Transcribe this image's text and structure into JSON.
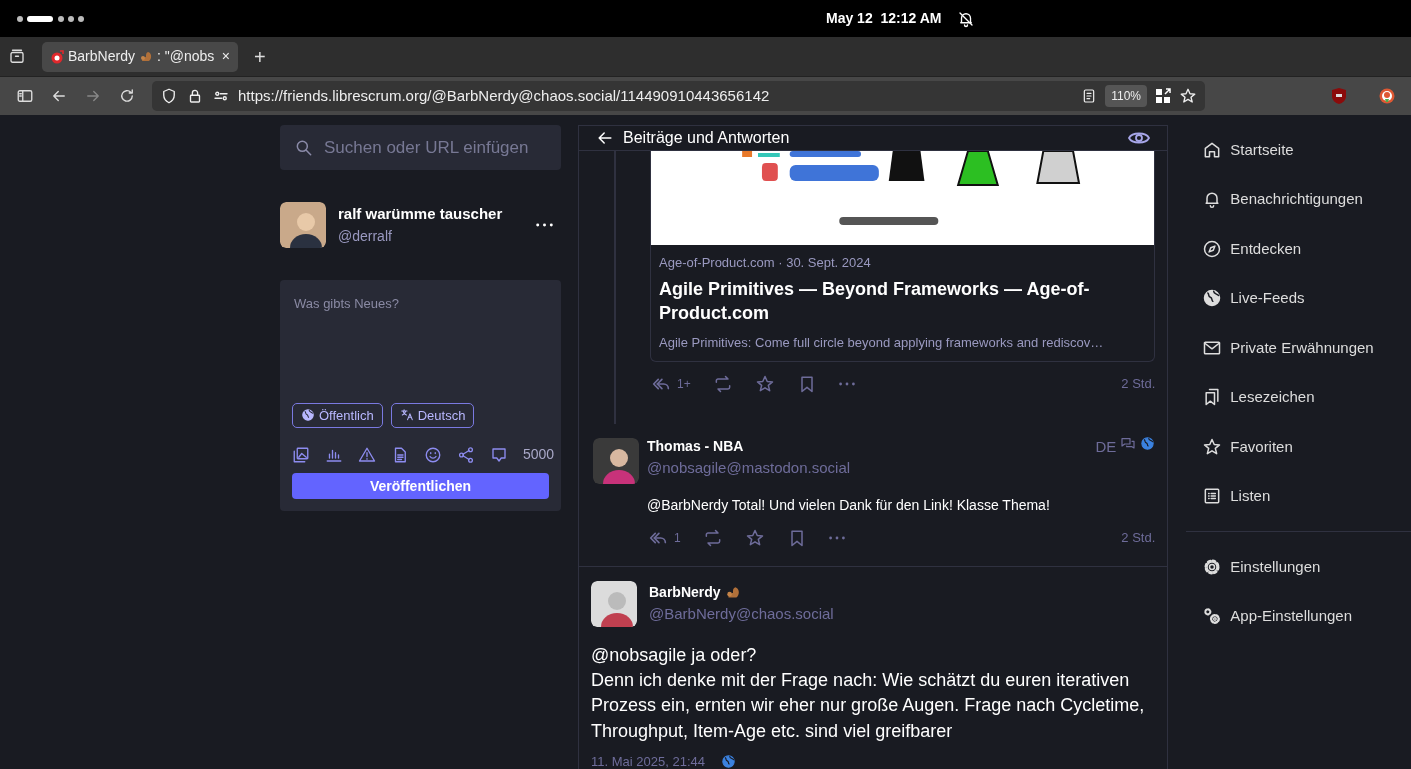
{
  "system_bar": {
    "date": "May 12",
    "time": "12:12 AM"
  },
  "browser": {
    "tab": {
      "title_start": "BarbNerdy",
      "title_end": ": \"@nobs",
      "selected": true
    },
    "close": "×",
    "new_tab": "+",
    "url": "https://friends.librescrum.org/@BarbNerdy@chaos.social/114490910443656142",
    "zoom": "110%"
  },
  "search": {
    "placeholder": "Suchen oder URL einfügen"
  },
  "account": {
    "name": "ralf warümme tauscher",
    "handle": "@derralf"
  },
  "composer": {
    "placeholder": "Was gibts Neues?",
    "visibility": "Öffentlich",
    "language": "Deutsch",
    "counter": "5000",
    "submit": "Veröffentlichen"
  },
  "column": {
    "title": "Beiträge und Antworten"
  },
  "link_card": {
    "meta": "Age-of-Product.com · 30. Sept. 2024",
    "title": "Agile Primitives — Beyond Frameworks — Age-of-Product.com",
    "description": "Agile Primitives: Come full circle beyond applying frameworks and rediscov…"
  },
  "posts": [
    {
      "kind": "thread_tail",
      "replies": "1+",
      "time": "2 Std."
    },
    {
      "kind": "reply",
      "name": "Thomas - NBA",
      "handle": "@nobsagile@mastodon.social",
      "language": "DE",
      "content": "@BarbNerdy Total! Und vielen Dank für den Link! Klasse Thema!",
      "replies": "1",
      "time": "2 Std."
    },
    {
      "kind": "focused",
      "name": "BarbNerdy",
      "handle": "@BarbNerdy@chaos.social",
      "content": "@nobsagile ja oder?\nDenn ich denke mit der Frage nach: Wie schätzt du euren iterativen Prozess ein, ernten wir eher nur große Augen. Frage nach Cycletime, Throughput, Item-Age etc. sind viel greifbarer",
      "date": "11. Mai 2025, 21:44"
    }
  ],
  "nav": [
    {
      "label": "Startseite"
    },
    {
      "label": "Benachrichtigungen"
    },
    {
      "label": "Entdecken"
    },
    {
      "label": "Live-Feeds"
    },
    {
      "label": "Private Erwähnungen"
    },
    {
      "label": "Lesezeichen"
    },
    {
      "label": "Favoriten"
    },
    {
      "label": "Listen"
    }
  ],
  "settings_nav": [
    {
      "label": "Einstellungen"
    },
    {
      "label": "App-Einstellungen"
    }
  ]
}
